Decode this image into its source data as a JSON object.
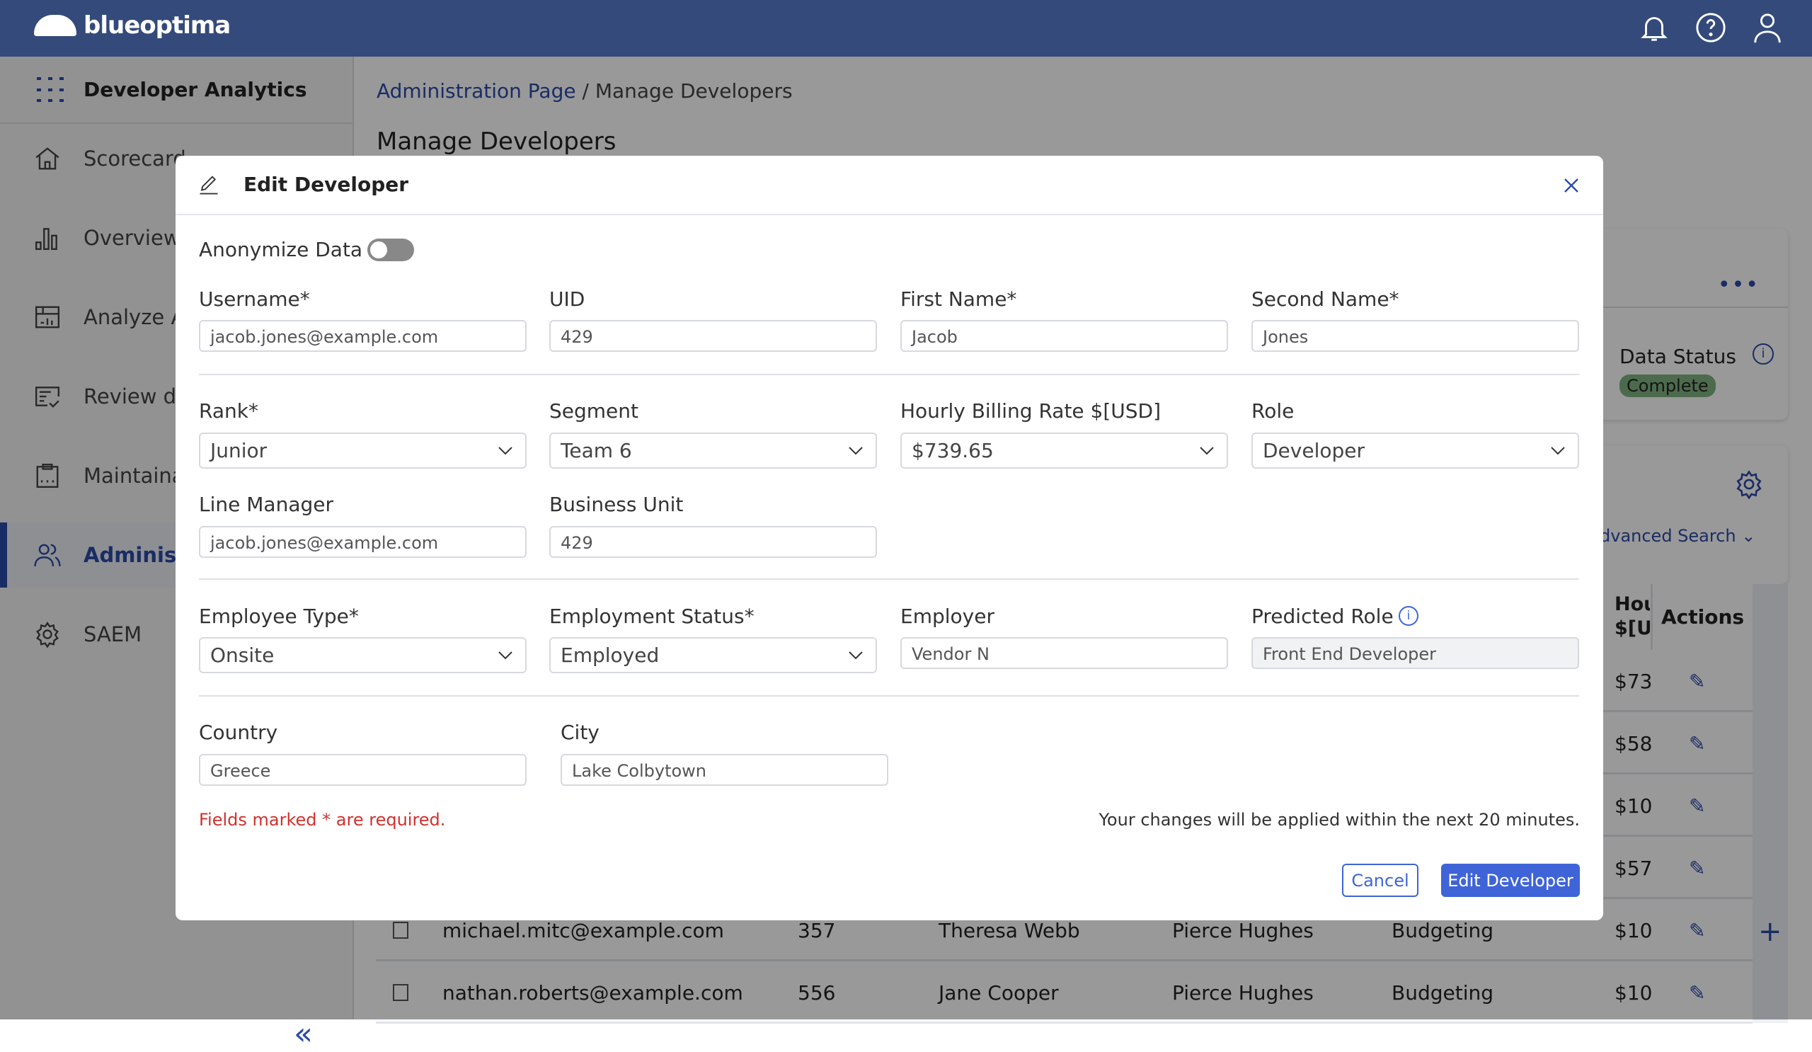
{
  "app": {
    "brand": "blueoptima",
    "product": "Developer Analytics"
  },
  "sidebar": {
    "items": [
      {
        "label": "Scorecard",
        "icon": "home-icon"
      },
      {
        "label": "Overview",
        "icon": "bar-chart-icon"
      },
      {
        "label": "Analyze AC",
        "icon": "analytics-icon"
      },
      {
        "label": "Review del",
        "icon": "review-icon"
      },
      {
        "label": "Maintainab",
        "icon": "clipboard-icon"
      },
      {
        "label": "Administa",
        "icon": "users-icon",
        "active": true
      },
      {
        "label": "SAEM",
        "icon": "gear-icon"
      }
    ]
  },
  "breadcrumb": {
    "parent": "Administration Page",
    "separator": "/",
    "current": "Manage Developers"
  },
  "page": {
    "title": "Manage Developers",
    "data_status_label": "Data Status",
    "data_status": "Complete",
    "advanced_search": "dvanced Search",
    "table": {
      "headers": {
        "hourly": "Hou\n$[U",
        "actions": "Actions"
      },
      "partial_rows": [
        "$73",
        "$58",
        "$10",
        "$57"
      ],
      "rows": [
        {
          "username": "michael.mitc@example.com",
          "uid": "357",
          "line_manager": "Theresa Webb",
          "manager2": "Pierce Hughes",
          "unit": "Budgeting",
          "rate": "$10"
        },
        {
          "username": "nathan.roberts@example.com",
          "uid": "556",
          "line_manager": "Jane Cooper",
          "manager2": "Pierce Hughes",
          "unit": "Budgeting",
          "rate": "$10"
        }
      ]
    }
  },
  "modal": {
    "title": "Edit Developer",
    "anonymize_label": "Anonymize Data",
    "anonymize": false,
    "fields": {
      "username": {
        "label": "Username*",
        "value": "jacob.jones@example.com"
      },
      "uid": {
        "label": "UID",
        "value": "429"
      },
      "first_name": {
        "label": "First Name*",
        "value": "Jacob"
      },
      "second_name": {
        "label": "Second Name*",
        "value": "Jones"
      },
      "rank": {
        "label": "Rank*",
        "value": "Junior"
      },
      "segment": {
        "label": "Segment",
        "value": "Team 6"
      },
      "rate": {
        "label": "Hourly Billing Rate $[USD]",
        "value": "$739.65"
      },
      "role": {
        "label": "Role",
        "value": "Developer"
      },
      "line_manager": {
        "label": "Line Manager",
        "value": "jacob.jones@example.com"
      },
      "business_unit": {
        "label": "Business Unit",
        "value": "429"
      },
      "employee_type": {
        "label": "Employee Type*",
        "value": "Onsite"
      },
      "employment_status": {
        "label": "Employment Status*",
        "value": "Employed"
      },
      "employer": {
        "label": "Employer",
        "value": "Vendor N"
      },
      "predicted_role": {
        "label": "Predicted Role",
        "value": "Front End Developer"
      },
      "country": {
        "label": "Country",
        "value": "Greece"
      },
      "city": {
        "label": "City",
        "value": "Lake Colbytown"
      }
    },
    "required_note": "Fields marked * are required.",
    "apply_note": "Your changes will be applied within the next 20 minutes.",
    "cancel": "Cancel",
    "submit": "Edit Developer"
  },
  "colors": {
    "header": "#344a7a",
    "accent": "#2c4aa8",
    "primary_button": "#3f64d8",
    "error": "#d0312d",
    "status_complete": "#7fb27f"
  }
}
